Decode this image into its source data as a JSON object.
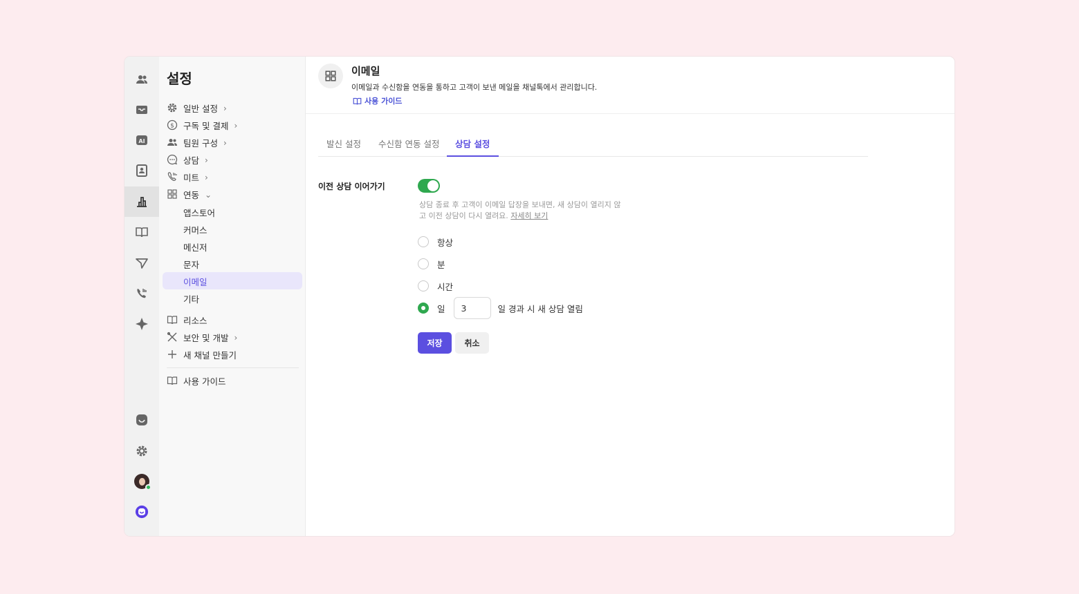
{
  "sidebar": {
    "title": "설정",
    "items": [
      {
        "label": "일반 설정",
        "icon": "gear-icon",
        "chevron": "›"
      },
      {
        "label": "구독 및 결제",
        "icon": "dollar-icon",
        "chevron": "›"
      },
      {
        "label": "팀원 구성",
        "icon": "people-icon",
        "chevron": "›"
      },
      {
        "label": "상담",
        "icon": "chat-icon",
        "chevron": "›"
      },
      {
        "label": "미트",
        "icon": "phone-icon",
        "chevron": "›"
      },
      {
        "label": "연동",
        "icon": "grid-icon",
        "chevron": "⌄"
      }
    ],
    "sub_items": [
      "앱스토어",
      "커머스",
      "메신저",
      "문자",
      "이메일",
      "기타"
    ],
    "bottom_items": [
      {
        "label": "리소스",
        "icon": "book-icon"
      },
      {
        "label": "보안 및 개발",
        "icon": "tools-icon",
        "chevron": "›"
      },
      {
        "label": "새 채널 만들기",
        "icon": "plus-icon"
      }
    ],
    "guide": {
      "label": "사용 가이드",
      "icon": "book-icon"
    }
  },
  "header": {
    "title": "이메일",
    "description": "이메일과 수신함을 연동을 통하고 고객이 보낸 메일을 채널톡에서 관리합니다.",
    "guide_link": "사용 가이드"
  },
  "tabs": [
    "발신 설정",
    "수신함 연동 설정",
    "상담 설정"
  ],
  "active_tab": "상담 설정",
  "continue_setting": {
    "label": "이전 상담 이어가기",
    "enabled": true,
    "help_text": "상담 종료 후 고객이 이메일 답장을 보내면, 새 상담이 열리지 않고 이전 상담이 다시 열려요.",
    "help_link": "자세히 보기"
  },
  "radio_options": [
    "항상",
    "분",
    "시간",
    "일"
  ],
  "selected_option": "일",
  "days_value": "3",
  "days_suffix": "일 경과 시 새 상담 열림",
  "buttons": {
    "save": "저장",
    "cancel": "취소"
  },
  "colors": {
    "accent": "#5b4fe0",
    "toggle_on": "#2fa84f",
    "background": "#fdecef"
  }
}
